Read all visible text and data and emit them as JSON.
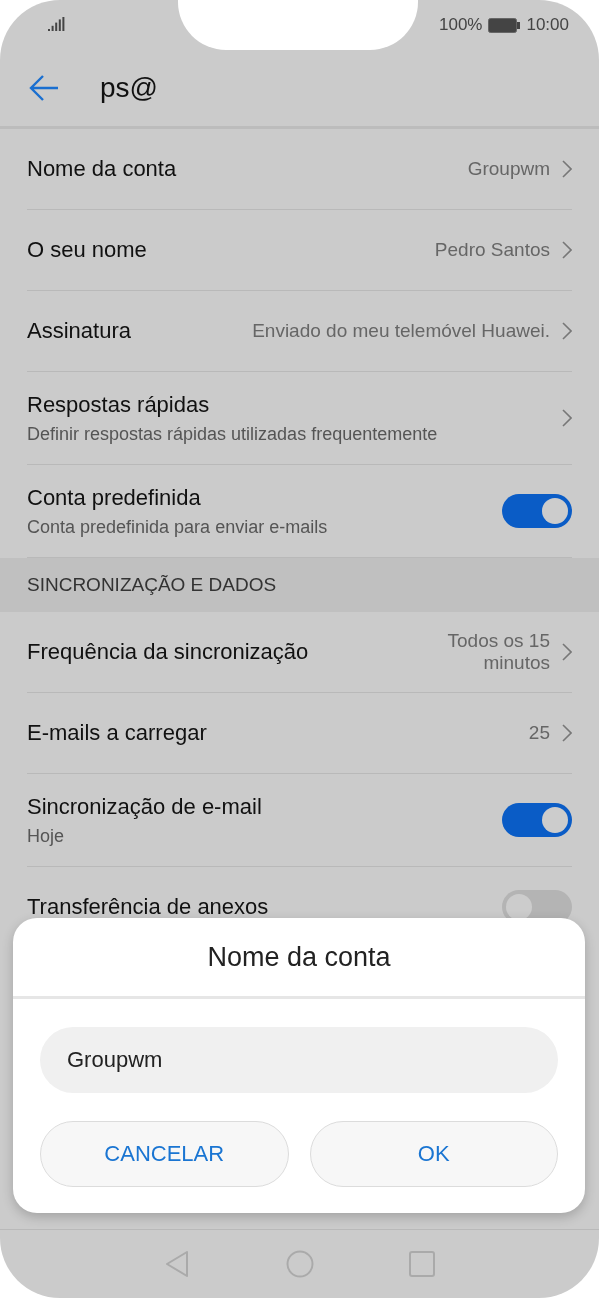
{
  "status_bar": {
    "battery": "100%",
    "time": "10:00"
  },
  "header": {
    "title": "ps@"
  },
  "sections": [
    {
      "rows": [
        {
          "kind": "link",
          "title": "Nome da conta",
          "value": "Groupwm"
        },
        {
          "kind": "link",
          "title": "O seu nome",
          "value": "Pedro Santos"
        },
        {
          "kind": "link",
          "title": "Assinatura",
          "value": "Enviado do meu telemóvel Huawei."
        },
        {
          "kind": "link",
          "title": "Respostas rápidas",
          "subtitle": "Definir respostas rápidas utilizadas frequentemente"
        },
        {
          "kind": "toggle",
          "title": "Conta predefinida",
          "subtitle": "Conta predefinida para enviar e-mails",
          "on": true
        }
      ]
    },
    {
      "header": "SINCRONIZAÇÃO E DADOS",
      "rows": [
        {
          "kind": "link",
          "title": "Frequência da sincronização",
          "value": "Todos os 15 minutos"
        },
        {
          "kind": "link",
          "title": "E-mails a carregar",
          "value": "25"
        },
        {
          "kind": "toggle",
          "title": "Sincronização de e-mail",
          "subtitle": "Hoje",
          "on": true
        },
        {
          "kind": "toggle",
          "title": "Transferência de anexos",
          "on": false
        }
      ]
    }
  ],
  "dialog": {
    "title": "Nome da conta",
    "input": {
      "value": "Groupwm"
    },
    "buttons": [
      "CANCELAR",
      "OK"
    ]
  }
}
